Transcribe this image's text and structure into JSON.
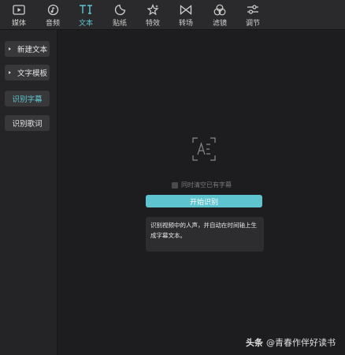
{
  "toolbar": {
    "items": [
      {
        "label": "媒体",
        "icon": "media-icon"
      },
      {
        "label": "音频",
        "icon": "audio-icon"
      },
      {
        "label": "文本",
        "icon": "text-icon",
        "active": true
      },
      {
        "label": "贴纸",
        "icon": "sticker-icon"
      },
      {
        "label": "特效",
        "icon": "effects-icon"
      },
      {
        "label": "转场",
        "icon": "transition-icon"
      },
      {
        "label": "滤镜",
        "icon": "filter-icon"
      },
      {
        "label": "调节",
        "icon": "adjust-icon"
      }
    ]
  },
  "sidebar": {
    "items": [
      {
        "label": "新建文本",
        "expandable": true
      },
      {
        "label": "文字模板",
        "expandable": true
      },
      {
        "label": "识别字幕",
        "active": true
      },
      {
        "label": "识别歌词"
      }
    ]
  },
  "main": {
    "icon": "auto-caption-icon",
    "checkbox_label": "同时清空已有字幕",
    "checkbox_checked": false,
    "start_button": "开始识别",
    "info_text": "识别视频中的人声，并自动在时间轴上生成字幕文本。"
  },
  "watermark": {
    "brand": "头条",
    "text": "@青春作伴好读书"
  },
  "colors": {
    "accent": "#5ec4cf",
    "background": "#1d1d1f",
    "toolbar": "#2a2a2c"
  }
}
